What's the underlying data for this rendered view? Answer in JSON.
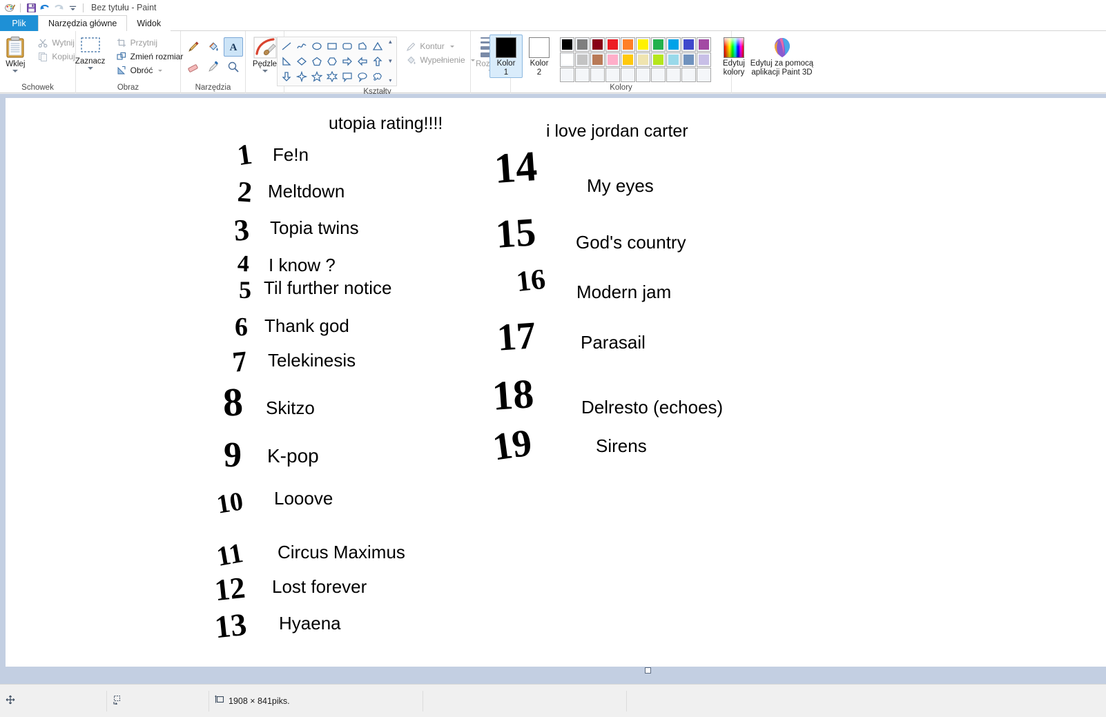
{
  "window": {
    "title": "Bez tytułu - Paint",
    "quick_access": [
      {
        "name": "paint-app-icon",
        "glyph": "paint"
      },
      {
        "name": "save-icon",
        "glyph": "save"
      },
      {
        "name": "undo-icon",
        "glyph": "undo"
      },
      {
        "name": "redo-icon",
        "glyph": "redo"
      },
      {
        "name": "customize-qat-icon",
        "glyph": "caret"
      }
    ]
  },
  "tabs": {
    "file": "Plik",
    "home": "Narzędzia główne",
    "view": "Widok"
  },
  "ribbon": {
    "clipboard": {
      "label": "Schowek",
      "paste": "Wklej",
      "cut": "Wytnij",
      "copy": "Kopiuj"
    },
    "image": {
      "label": "Obraz",
      "select": "Zaznacz",
      "crop": "Przytnij",
      "resize": "Zmień rozmiar",
      "rotate": "Obróć"
    },
    "tools": {
      "label": "Narzędzia",
      "items": [
        {
          "name": "pencil-tool",
          "selected": false
        },
        {
          "name": "fill-tool",
          "selected": false
        },
        {
          "name": "text-tool",
          "selected": true
        },
        {
          "name": "eraser-tool",
          "selected": false
        },
        {
          "name": "color-picker-tool",
          "selected": false
        },
        {
          "name": "magnifier-tool",
          "selected": false
        }
      ]
    },
    "brushes": {
      "label": "Pędzle"
    },
    "shapes": {
      "label": "Kształty"
    },
    "outline_fill": {
      "outline": "Kontur",
      "fill": "Wypełnienie"
    },
    "size": {
      "label": "Rozmiar"
    },
    "colors": {
      "label": "Kolory",
      "color1": "Kolor\n1",
      "color1_line1": "Kolor",
      "color1_line2": "1",
      "color2_line1": "Kolor",
      "color2_line2": "2",
      "color1_value": "#000000",
      "color2_value": "#ffffff",
      "edit_colors_line1": "Edytuj",
      "edit_colors_line2": "kolory",
      "palette_row1": [
        "#000000",
        "#7f7f7f",
        "#880015",
        "#ed1c24",
        "#ff7f27",
        "#fff200",
        "#22b14c",
        "#00a2e8",
        "#3f48cc",
        "#a349a4"
      ],
      "palette_row2": [
        "#ffffff",
        "#c3c3c3",
        "#b97a57",
        "#ffaec9",
        "#ffc90e",
        "#efe4b0",
        "#b5e61d",
        "#99d9ea",
        "#7092be",
        "#c8bfe7"
      ],
      "palette_row3": [
        "",
        "",
        "",
        "",
        "",
        "",
        "",
        "",
        "",
        ""
      ]
    },
    "paint3d": {
      "line1": "Edytuj za pomocą",
      "line2": "aplikacji Paint 3D"
    }
  },
  "canvas": {
    "left_list": {
      "heading": "utopia rating!!!!",
      "items": [
        {
          "rank": "1",
          "title": "Fe!n"
        },
        {
          "rank": "2",
          "title": "Meltdown"
        },
        {
          "rank": "3",
          "title": "Topia twins"
        },
        {
          "rank": "4",
          "title": "I know ?"
        },
        {
          "rank": "5",
          "title": "Til further notice"
        },
        {
          "rank": "6",
          "title": "Thank god"
        },
        {
          "rank": "7",
          "title": "Telekinesis"
        },
        {
          "rank": "8",
          "title": "Skitzo"
        },
        {
          "rank": "9",
          "title": "K-pop"
        },
        {
          "rank": "10",
          "title": "Looove"
        },
        {
          "rank": "11",
          "title": "Circus Maximus"
        },
        {
          "rank": "12",
          "title": "Lost forever"
        },
        {
          "rank": "13",
          "title": "Hyaena"
        }
      ]
    },
    "right_list": {
      "heading": "i love jordan carter",
      "items": [
        {
          "rank": "14",
          "title": "My eyes"
        },
        {
          "rank": "15",
          "title": "God's country"
        },
        {
          "rank": "16",
          "title": "Modern jam"
        },
        {
          "rank": "17",
          "title": "Parasail"
        },
        {
          "rank": "18",
          "title": "Delresto (echoes)"
        },
        {
          "rank": "19",
          "title": "Sirens"
        }
      ]
    }
  },
  "statusbar": {
    "cursor_position": "",
    "selection_size": "",
    "image_size": "1908 × 841piks."
  }
}
